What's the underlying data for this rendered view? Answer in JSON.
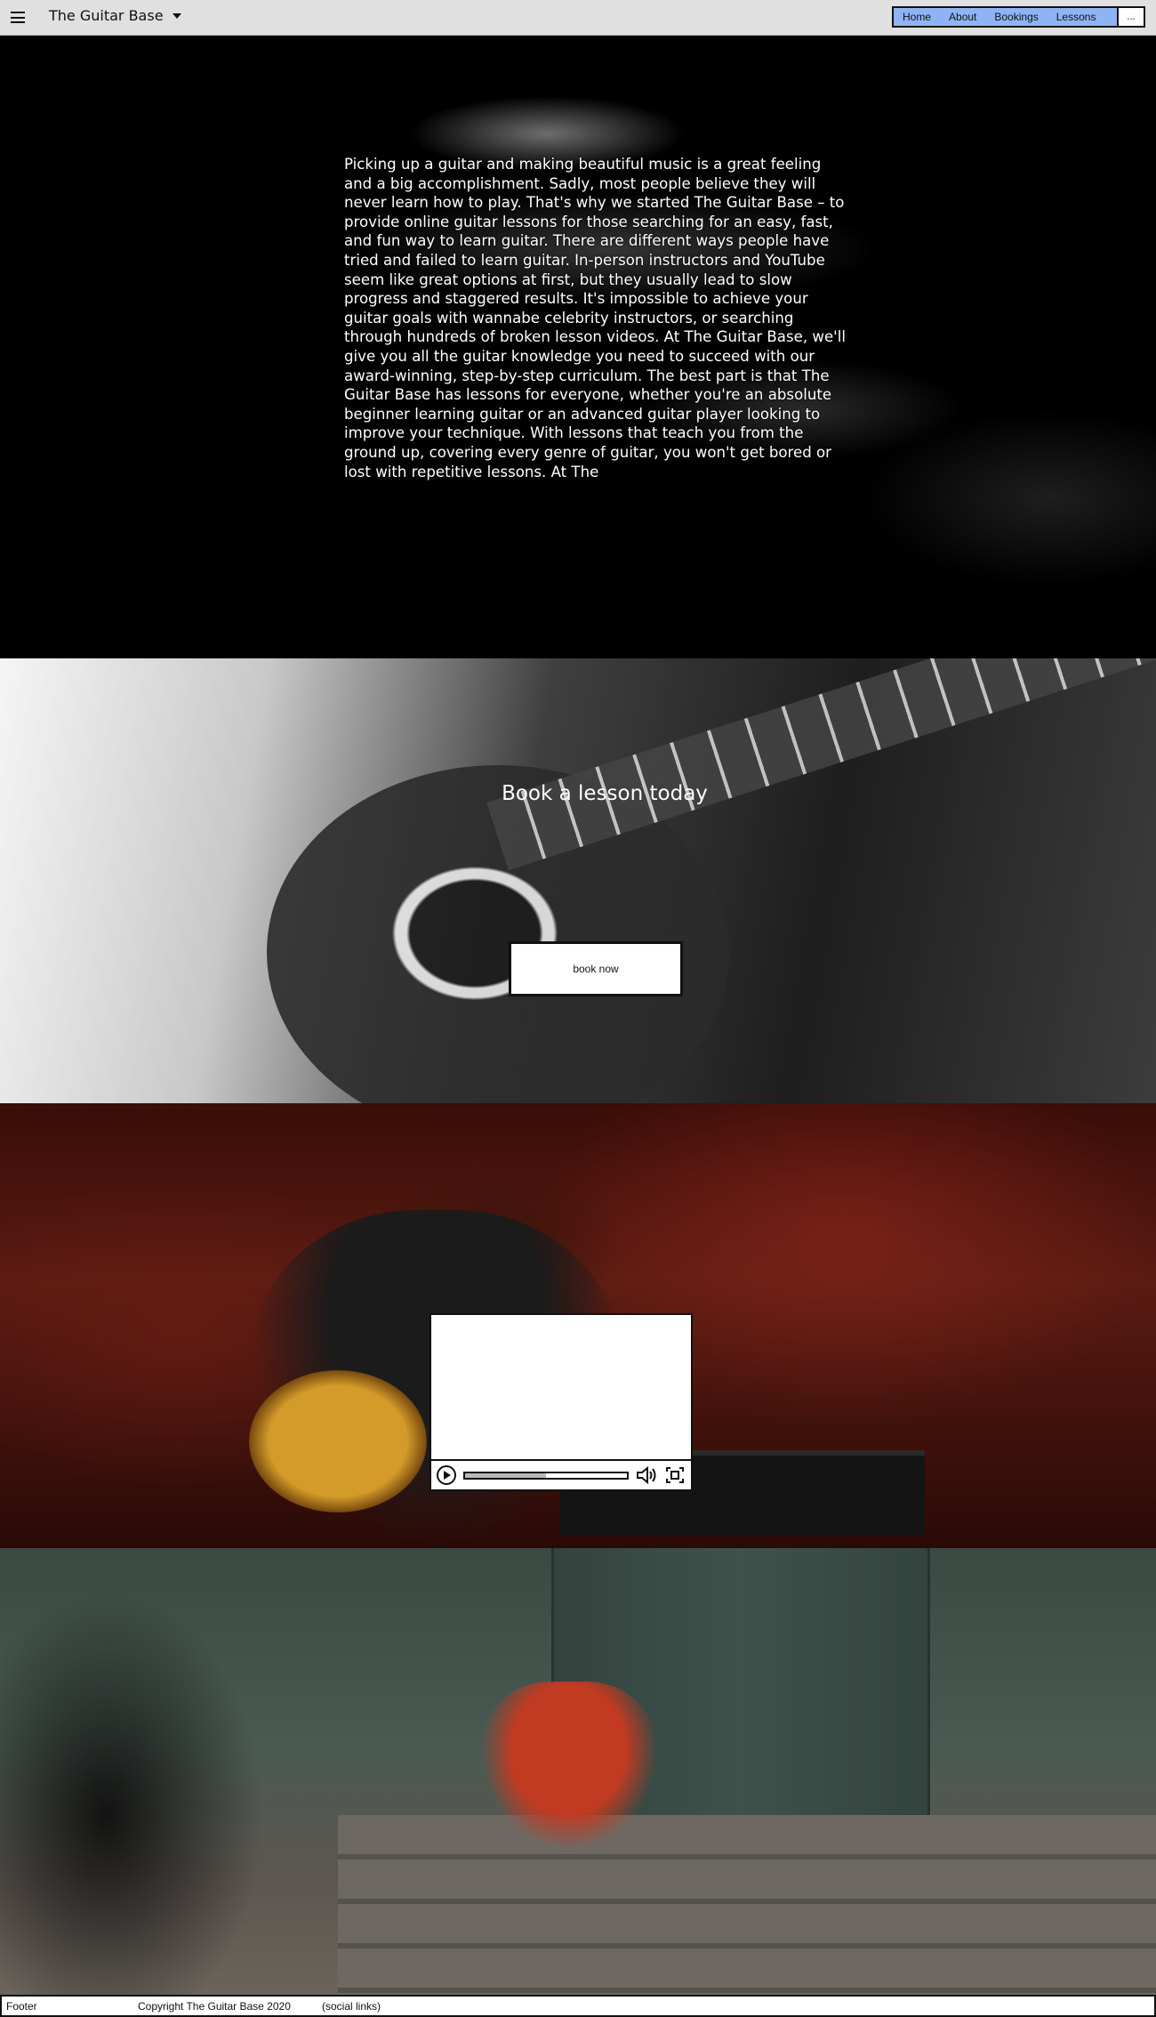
{
  "header": {
    "brand": "The Guitar Base",
    "nav": [
      "Home",
      "About",
      "Bookings",
      "Lessons"
    ],
    "more_label": "..."
  },
  "hero": {
    "text": "Picking up a guitar and making beautiful music is a great feeling and a big accomplishment. Sadly, most people believe they will never learn how to play. That's why we started The Guitar Base – to provide online guitar lessons for those searching for an easy, fast, and fun way to learn guitar. There are different ways people have tried and failed to learn guitar. In-person instructors and YouTube seem like great options at first, but they usually lead to slow progress and staggered results. It's impossible to achieve your guitar goals with wannabe celebrity instructors, or searching through hundreds of broken lesson videos. At The Guitar Base, we'll give you all the guitar knowledge you need to succeed with our award-winning, step-by-step curriculum. The best part is that The Guitar Base has lessons for everyone, whether you're an absolute beginner learning guitar or an advanced guitar player looking to improve your technique. With lessons that teach you from the ground up, covering every genre of guitar, you won't get bored or lost with repetitive lessons. At The"
  },
  "book": {
    "title": "Book a lesson today",
    "button_label": "book now"
  },
  "video": {
    "progress": 0.5
  },
  "footer": {
    "label": "Footer",
    "copyright": "Copyright The Guitar Base 2020",
    "social": "(social links)"
  }
}
